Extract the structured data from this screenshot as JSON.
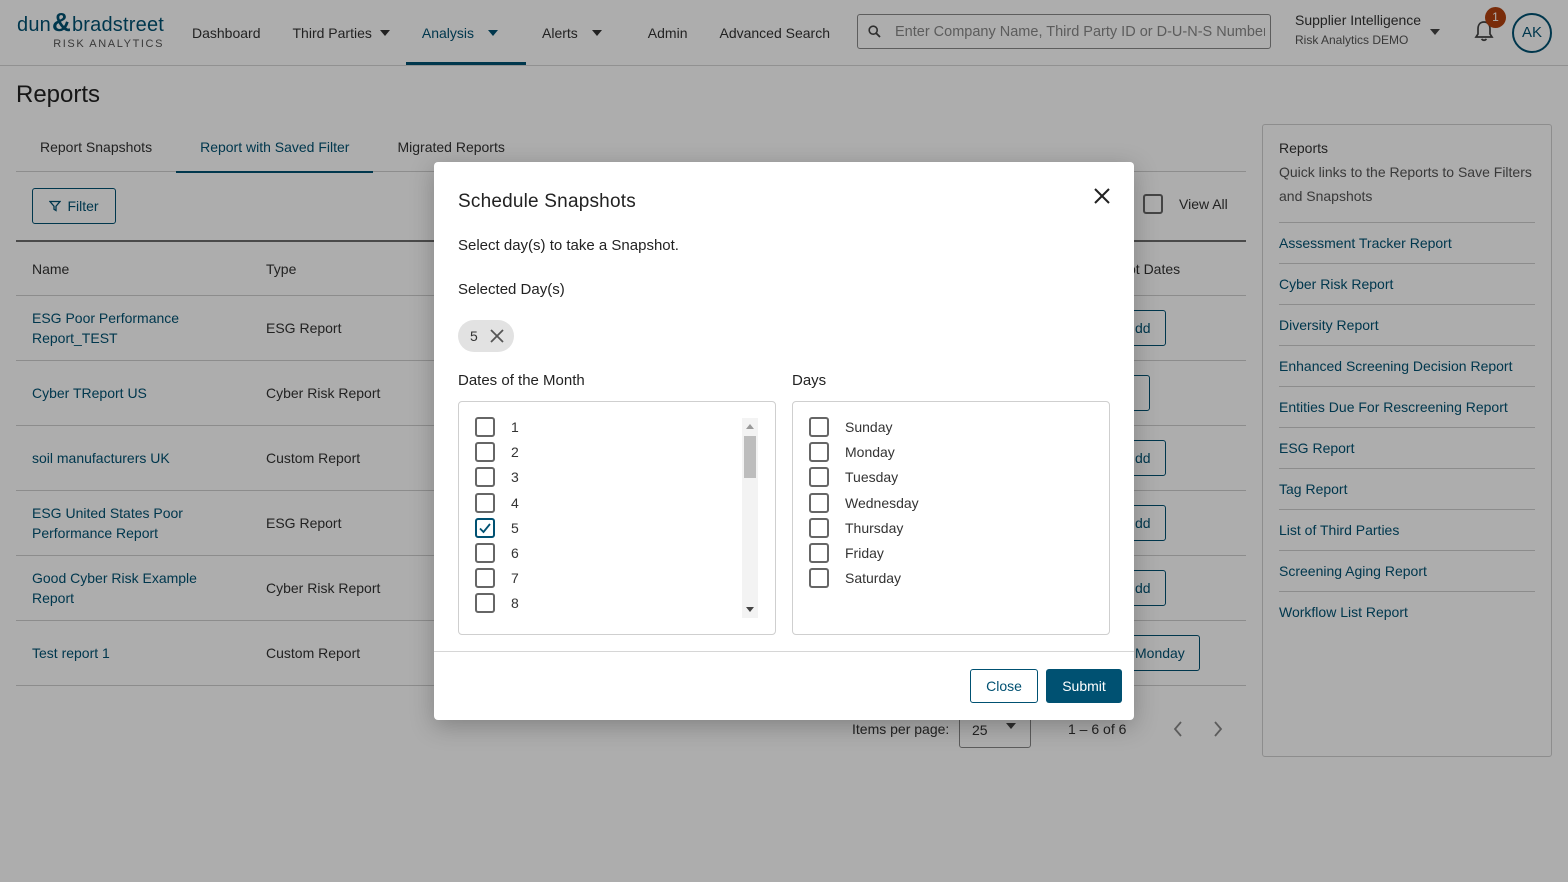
{
  "brand": {
    "name_left": "dun",
    "amp": "&",
    "name_right": "bradstreet",
    "sub": "RISK ANALYTICS",
    "color": "#005172"
  },
  "nav": {
    "items": [
      {
        "label": "Dashboard"
      },
      {
        "label": "Third Parties"
      },
      {
        "label": "Analysis"
      },
      {
        "label": "Alerts"
      },
      {
        "label": "Admin"
      },
      {
        "label": "Advanced Search"
      }
    ],
    "active": "Analysis"
  },
  "search": {
    "placeholder": "Enter Company Name, Third Party ID or D-U-N-S Number"
  },
  "supplier": {
    "title": "Supplier Intelligence",
    "subtitle": "Risk Analytics DEMO"
  },
  "notifications": {
    "count": "1"
  },
  "user": {
    "initials": "AK"
  },
  "page": {
    "title": "Reports"
  },
  "tabs": [
    {
      "label": "Report Snapshots"
    },
    {
      "label": "Report with Saved Filter"
    },
    {
      "label": "Migrated Reports"
    }
  ],
  "toolbar": {
    "filter_label": "Filter",
    "view_all_label": "View All"
  },
  "table": {
    "headers": {
      "name": "Name",
      "type": "Type",
      "snapshot_dates": "ot Dates"
    },
    "rows": [
      {
        "name": "ESG Poor Performance Report_TEST",
        "type": "ESG Report",
        "action": "dd"
      },
      {
        "name": "Cyber TReport US",
        "type": "Cyber Risk Report",
        "action": ""
      },
      {
        "name": "soil manufacturers UK",
        "type": "Custom Report",
        "action": "dd"
      },
      {
        "name": "ESG United States Poor Performance Report",
        "type": "ESG Report",
        "action": "dd"
      },
      {
        "name": "Good Cyber Risk Example Report",
        "type": "Cyber Risk Report",
        "action": "dd"
      },
      {
        "name": "Test report 1",
        "type": "Custom Report",
        "action": "Monday"
      }
    ]
  },
  "pagination": {
    "items_per_page_label": "Items per page:",
    "items_per_page": "25",
    "range": "1 – 6 of 6"
  },
  "right_panel": {
    "title": "Reports",
    "description": "Quick links to the Reports to Save Filters and Snapshots",
    "links": [
      "Assessment Tracker Report",
      "Cyber Risk Report",
      "Diversity Report",
      "Enhanced Screening Decision Report",
      "Entities Due For Rescreening Report",
      "ESG Report",
      "Tag Report",
      "List of Third Parties",
      "Screening Aging Report",
      "Workflow List Report"
    ]
  },
  "modal": {
    "title": "Schedule Snapshots",
    "subtitle": "Select day(s) to take a Snapshot.",
    "selected_label": "Selected Day(s)",
    "selected_chips": [
      "5"
    ],
    "dates_label": "Dates of the Month",
    "days_label": "Days",
    "dates": [
      {
        "label": "1",
        "checked": false
      },
      {
        "label": "2",
        "checked": false
      },
      {
        "label": "3",
        "checked": false
      },
      {
        "label": "4",
        "checked": false
      },
      {
        "label": "5",
        "checked": true
      },
      {
        "label": "6",
        "checked": false
      },
      {
        "label": "7",
        "checked": false
      },
      {
        "label": "8",
        "checked": false
      }
    ],
    "days": [
      {
        "label": "Sunday",
        "checked": false
      },
      {
        "label": "Monday",
        "checked": false
      },
      {
        "label": "Tuesday",
        "checked": false
      },
      {
        "label": "Wednesday",
        "checked": false
      },
      {
        "label": "Thursday",
        "checked": false
      },
      {
        "label": "Friday",
        "checked": false
      },
      {
        "label": "Saturday",
        "checked": false
      }
    ],
    "close_label": "Close",
    "submit_label": "Submit"
  }
}
